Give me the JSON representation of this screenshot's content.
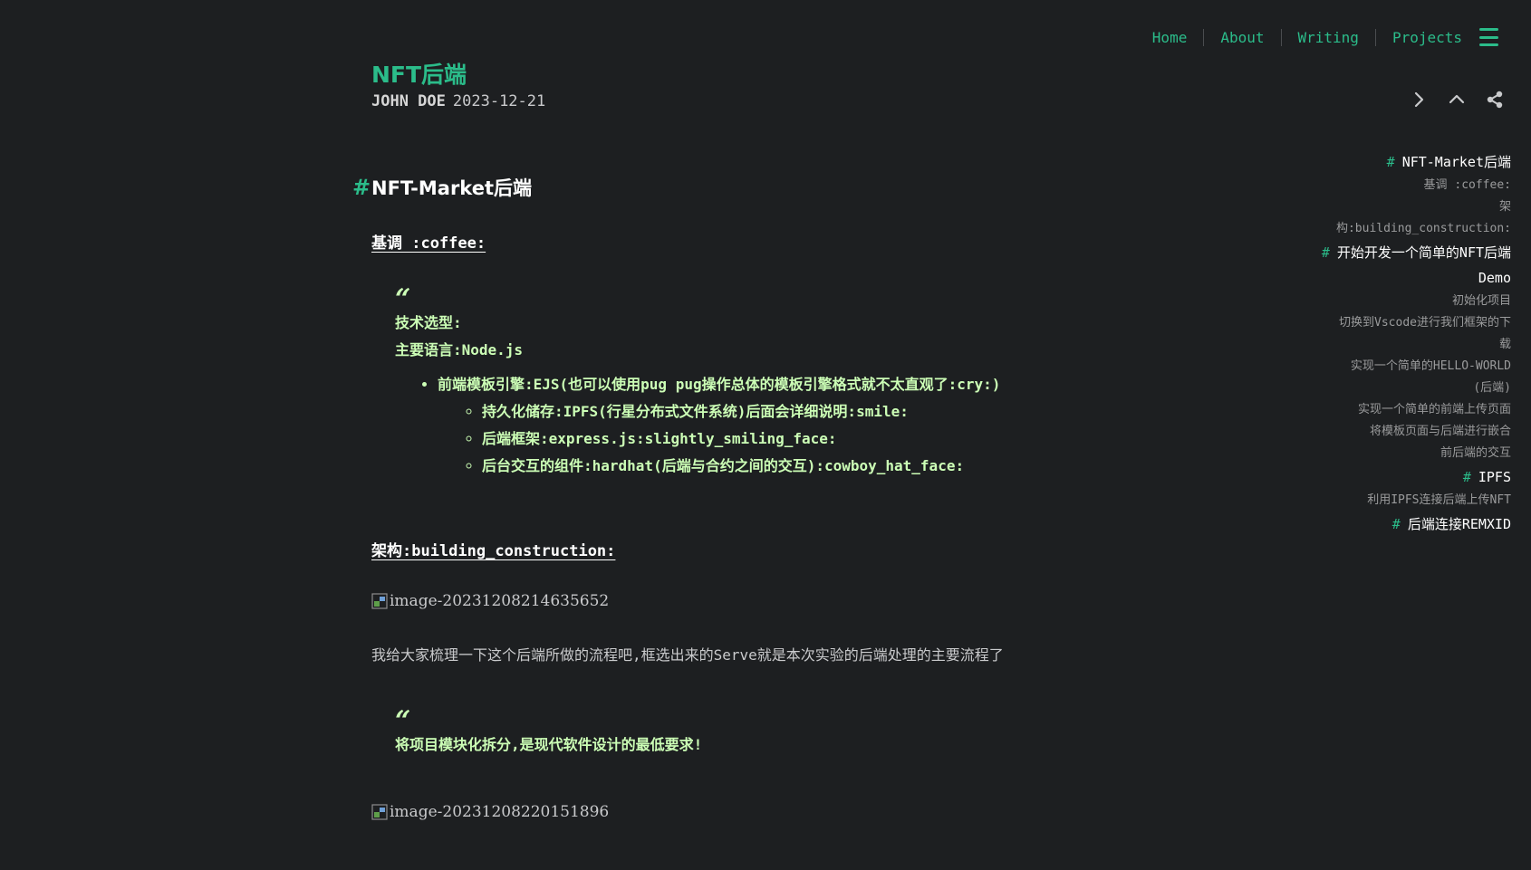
{
  "nav": {
    "links": [
      "Home",
      "About",
      "Writing",
      "Projects"
    ],
    "menu_icon": "hamburger-menu-icon"
  },
  "post": {
    "title": "NFT后端",
    "author": "JOHN DOE",
    "date": "2023-12-21"
  },
  "actions": {
    "icons": [
      "chevron-right-icon",
      "chevron-up-icon",
      "share-icon"
    ]
  },
  "article": {
    "h1": "NFT-Market后端",
    "h2_tone": "基调 :coffee:",
    "quote1": {
      "mark": "“",
      "line1": "技术选型:",
      "line2": "主要语言:Node.js",
      "bullet": "前端模板引擎:EJS(也可以使用pug pug操作总体的模板引擎格式就不太直观了:cry:)",
      "sub_bullets": [
        "持久化储存:IPFS(行星分布式文件系统)后面会详细说明:smile:",
        "后端框架:express.js:slightly_smiling_face:",
        "后台交互的组件:hardhat(后端与合约之间的交互):cowboy_hat_face:"
      ]
    },
    "h2_arch": "架构:building_construction:",
    "image1_alt": "image-20231208214635652",
    "para1": "我给大家梳理一下这个后端所做的流程吧,框选出来的Serve就是本次实验的后端处理的主要流程了",
    "quote2": {
      "mark": "“",
      "line1": "将项目模块化拆分,是现代软件设计的最低要求!"
    },
    "image2_alt": "image-20231208220151896"
  },
  "toc": [
    {
      "level": 1,
      "hash": "#",
      "text": "NFT-Market后端"
    },
    {
      "level": 2,
      "text": "基调 :coffee:"
    },
    {
      "level": 2,
      "text": "架"
    },
    {
      "level": 2,
      "text": "构:building_construction:"
    },
    {
      "level": 1,
      "hash": "#",
      "text": "开始开发一个简单的NFT后端"
    },
    {
      "level": 1,
      "text": "Demo"
    },
    {
      "level": 2,
      "text": "初始化项目"
    },
    {
      "level": 2,
      "text": "切换到Vscode进行我们框架的下"
    },
    {
      "level": 2,
      "text": "载"
    },
    {
      "level": 2,
      "text": "实现一个简单的HELLO-WORLD"
    },
    {
      "level": 2,
      "text": "(后端)"
    },
    {
      "level": 2,
      "text": "实现一个简单的前端上传页面"
    },
    {
      "level": 2,
      "text": "将模板页面与后端进行嵌合"
    },
    {
      "level": 2,
      "text": "前后端的交互"
    },
    {
      "level": 1,
      "hash": "#",
      "text": "IPFS"
    },
    {
      "level": 2,
      "text": "利用IPFS连接后端上传NFT"
    },
    {
      "level": 1,
      "hash": "#",
      "text": "后端连接REMXID"
    }
  ],
  "colors": {
    "background": "#1d1f21",
    "accent": "#2bbc8a",
    "quote_text": "#ccffb6",
    "text": "#c9cacc"
  }
}
